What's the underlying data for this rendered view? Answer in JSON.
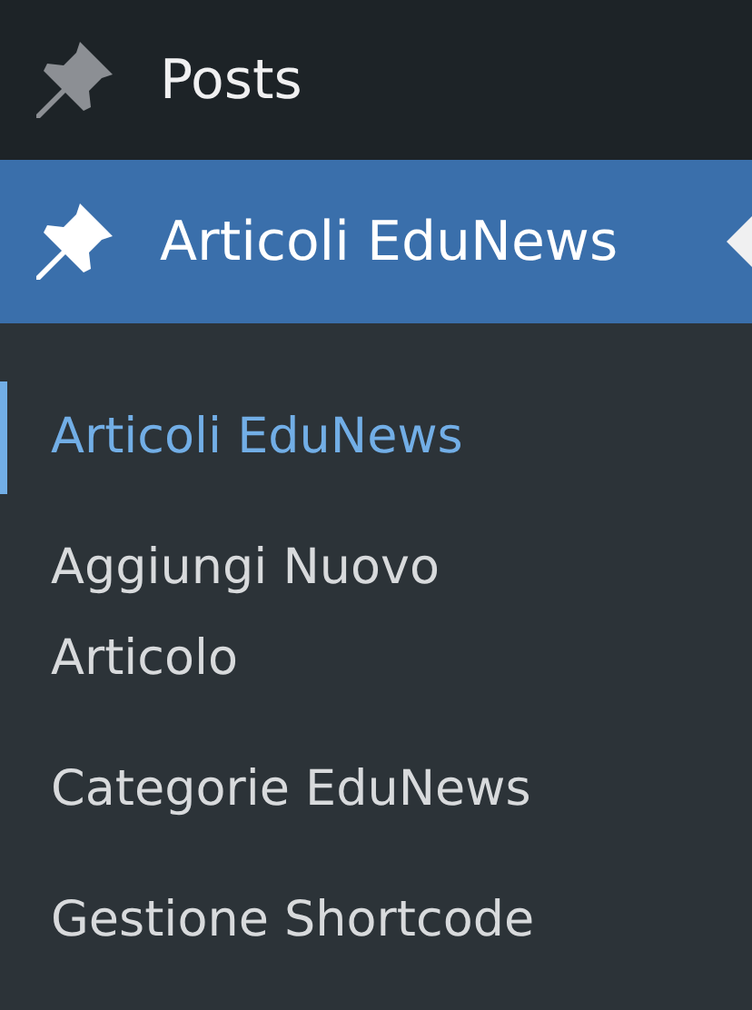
{
  "menu": [
    {
      "label": "Posts",
      "selected": false
    },
    {
      "label": "Articoli EduNews",
      "selected": true
    }
  ],
  "submenu": [
    {
      "label": "Articoli EduNews",
      "selected": true
    },
    {
      "label": "Aggiungi Nuovo Articolo",
      "selected": false
    },
    {
      "label": "Categorie EduNews",
      "selected": false
    },
    {
      "label": "Gestione Shortcode",
      "selected": false
    }
  ]
}
